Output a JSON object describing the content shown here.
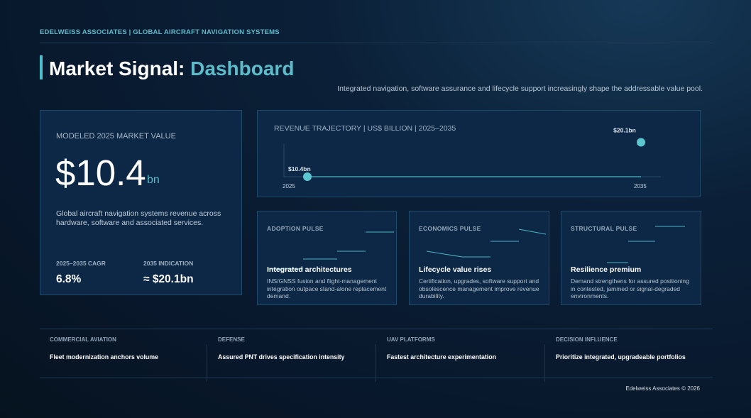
{
  "brand": "EDELWEISS ASSOCIATES | GLOBAL AIRCRAFT NAVIGATION SYSTEMS",
  "title": {
    "main": "Market Signal:",
    "accent": "Dashboard"
  },
  "subtitle": "Integrated navigation, software assurance and lifecycle support increasingly shape the addressable value pool.",
  "market_value": {
    "label": "MODELED 2025 MARKET VALUE",
    "value": "$10.4",
    "unit": "bn",
    "description": "Global aircraft navigation systems revenue across hardware, software and associated services.",
    "stats": [
      {
        "label": "2025–2035 CAGR",
        "value": "6.8%"
      },
      {
        "label": "2035 INDICATION",
        "value": "≈ $20.1bn"
      }
    ]
  },
  "revenue": {
    "title": "REVENUE TRAJECTORY | US$ BILLION | 2025–2035",
    "start_label": "$10.4bn",
    "end_label": "$20.1bn",
    "start_year": "2025",
    "end_year": "2035"
  },
  "chart_data": {
    "type": "scatter",
    "title": "REVENUE TRAJECTORY | US$ BILLION | 2025–2035",
    "x": [
      2025,
      2035
    ],
    "y": [
      10.4,
      20.1
    ],
    "point_labels": [
      "$10.4bn",
      "$20.1bn"
    ],
    "tick_labels": [
      "2025",
      "2035"
    ],
    "grid": false
  },
  "pulses": [
    {
      "label": "ADOPTION PULSE",
      "title": "Integrated architectures",
      "description": "INS/GNSS fusion and flight-management integration outpace stand-alone replacement demand."
    },
    {
      "label": "ECONOMICS PULSE",
      "title": "Lifecycle value rises",
      "description": "Certification, upgrades, software support and obsolescence management improve revenue durability."
    },
    {
      "label": "STRUCTURAL PULSE",
      "title": "Resilience premium",
      "description": "Demand strengthens for assured positioning in contested, jammed or signal-degraded environments."
    }
  ],
  "segments": [
    {
      "label": "COMMERCIAL AVIATION",
      "text": "Fleet modernization anchors volume"
    },
    {
      "label": "DEFENSE",
      "text": "Assured PNT drives specification intensity"
    },
    {
      "label": "UAV PLATFORMS",
      "text": "Fastest architecture experimentation"
    },
    {
      "label": "DECISION INFLUENCE",
      "text": "Prioritize integrated, upgradeable portfolios"
    }
  ],
  "footer": "Edelweiss Associates © 2026",
  "colors": {
    "accent": "#5cbcc9",
    "background": "#08172b",
    "card": "#0c2846",
    "border": "#1f4a6a"
  }
}
